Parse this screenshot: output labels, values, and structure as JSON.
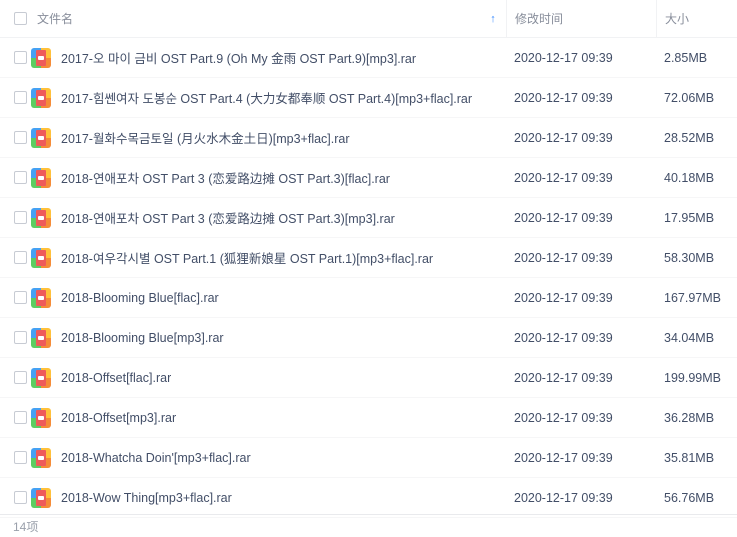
{
  "header": {
    "name_label": "文件名",
    "time_label": "修改时间",
    "size_label": "大小",
    "sort_icon": "arrow-up-icon",
    "accent_color": "#3b8cff"
  },
  "files": [
    {
      "name": "2017-오 마이 금비 OST Part.9 (Oh My 金雨 OST Part.9)[mp3].rar",
      "time": "2020-12-17 09:39",
      "size": "2.85MB"
    },
    {
      "name": "2017-힘쎈여자 도봉순 OST Part.4 (大力女都奉顺 OST Part.4)[mp3+flac].rar",
      "time": "2020-12-17 09:39",
      "size": "72.06MB"
    },
    {
      "name": "2017-월화수목금토일 (月火水木金土日)[mp3+flac].rar",
      "time": "2020-12-17 09:39",
      "size": "28.52MB"
    },
    {
      "name": "2018-연애포차 OST Part 3 (恋爱路边摊 OST Part.3)[flac].rar",
      "time": "2020-12-17 09:39",
      "size": "40.18MB"
    },
    {
      "name": "2018-연애포차 OST Part 3 (恋爱路边摊 OST Part.3)[mp3].rar",
      "time": "2020-12-17 09:39",
      "size": "17.95MB"
    },
    {
      "name": "2018-여우각시별 OST Part.1 (狐狸新娘星 OST Part.1)[mp3+flac].rar",
      "time": "2020-12-17 09:39",
      "size": "58.30MB"
    },
    {
      "name": "2018-Blooming Blue[flac].rar",
      "time": "2020-12-17 09:39",
      "size": "167.97MB"
    },
    {
      "name": "2018-Blooming Blue[mp3].rar",
      "time": "2020-12-17 09:39",
      "size": "34.04MB"
    },
    {
      "name": "2018-Offset[flac].rar",
      "time": "2020-12-17 09:39",
      "size": "199.99MB"
    },
    {
      "name": "2018-Offset[mp3].rar",
      "time": "2020-12-17 09:39",
      "size": "36.28MB"
    },
    {
      "name": "2018-Whatcha Doin'[mp3+flac].rar",
      "time": "2020-12-17 09:39",
      "size": "35.81MB"
    },
    {
      "name": "2018-Wow Thing[mp3+flac].rar",
      "time": "2020-12-17 09:39",
      "size": "56.76MB"
    }
  ],
  "file_icon": "rar-archive-icon",
  "footer": {
    "count_label": "14项"
  }
}
